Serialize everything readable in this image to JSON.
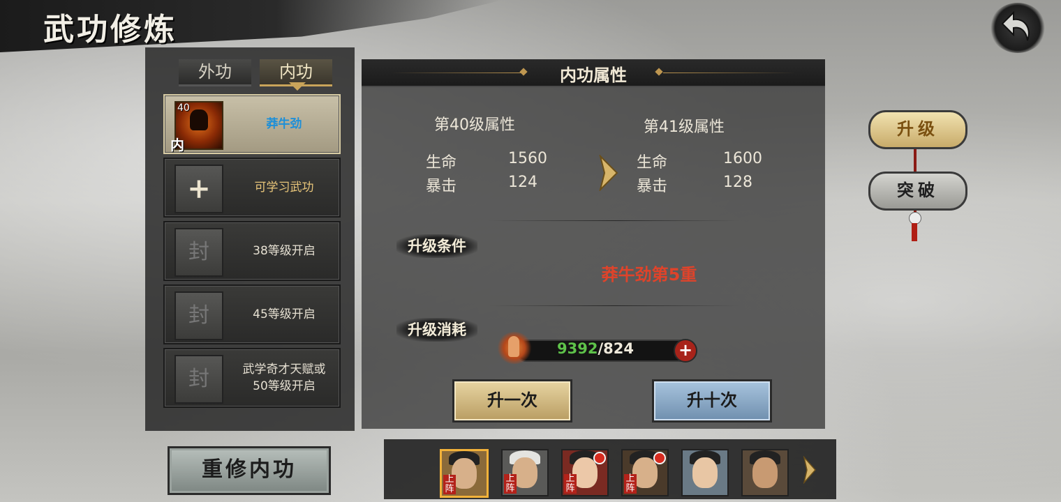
{
  "header": {
    "title": "武功修炼"
  },
  "tabs": [
    {
      "label": "外功",
      "active": false
    },
    {
      "label": "内功",
      "active": true
    }
  ],
  "skill_slots": [
    {
      "level": "40",
      "type_badge": "内",
      "name": "莽牛劲",
      "state": "selected"
    },
    {
      "icon": "plus-icon",
      "text": "可学习武功",
      "state": "available"
    },
    {
      "icon": "lock-seal-icon",
      "icon_glyph": "封",
      "text": "38等级开启",
      "state": "locked"
    },
    {
      "icon": "lock-seal-icon",
      "icon_glyph": "封",
      "text": "45等级开启",
      "state": "locked"
    },
    {
      "icon": "lock-seal-icon",
      "icon_glyph": "封",
      "text": "武学奇才天赋或\n50等级开启",
      "state": "locked"
    }
  ],
  "redo_button": "重修内功",
  "main": {
    "title": "内功属性",
    "current": {
      "heading": "第40级属性",
      "stats": [
        {
          "label": "生命",
          "value": "1560"
        },
        {
          "label": "暴击",
          "value": "124"
        }
      ]
    },
    "next": {
      "heading": "第41级属性",
      "stats": [
        {
          "label": "生命",
          "value": "1600"
        },
        {
          "label": "暴击",
          "value": "128"
        }
      ]
    },
    "requirement_label": "升级条件",
    "requirement_text": "莽牛劲第5重",
    "cost_label": "升级消耗",
    "cost_have": "9392",
    "cost_sep": "/",
    "cost_need": "824",
    "upgrade_once": "升一次",
    "upgrade_ten": "升十次"
  },
  "side_tabs": [
    {
      "label": "升级",
      "active": true
    },
    {
      "label": "突破",
      "active": false
    }
  ],
  "heroes": [
    {
      "tag": "上阵",
      "selected": true,
      "notify": false
    },
    {
      "tag": "上阵",
      "selected": false,
      "notify": false
    },
    {
      "tag": "上阵",
      "selected": false,
      "notify": true
    },
    {
      "tag": "上阵",
      "selected": false,
      "notify": true
    },
    {
      "tag": "",
      "selected": false,
      "notify": false
    },
    {
      "tag": "",
      "selected": false,
      "notify": false
    }
  ],
  "colors": {
    "accent_gold": "#c9a45a",
    "requirement_red": "#e0432a",
    "have_green": "#5ec24a",
    "skill_name_blue": "#1d8fd8"
  }
}
